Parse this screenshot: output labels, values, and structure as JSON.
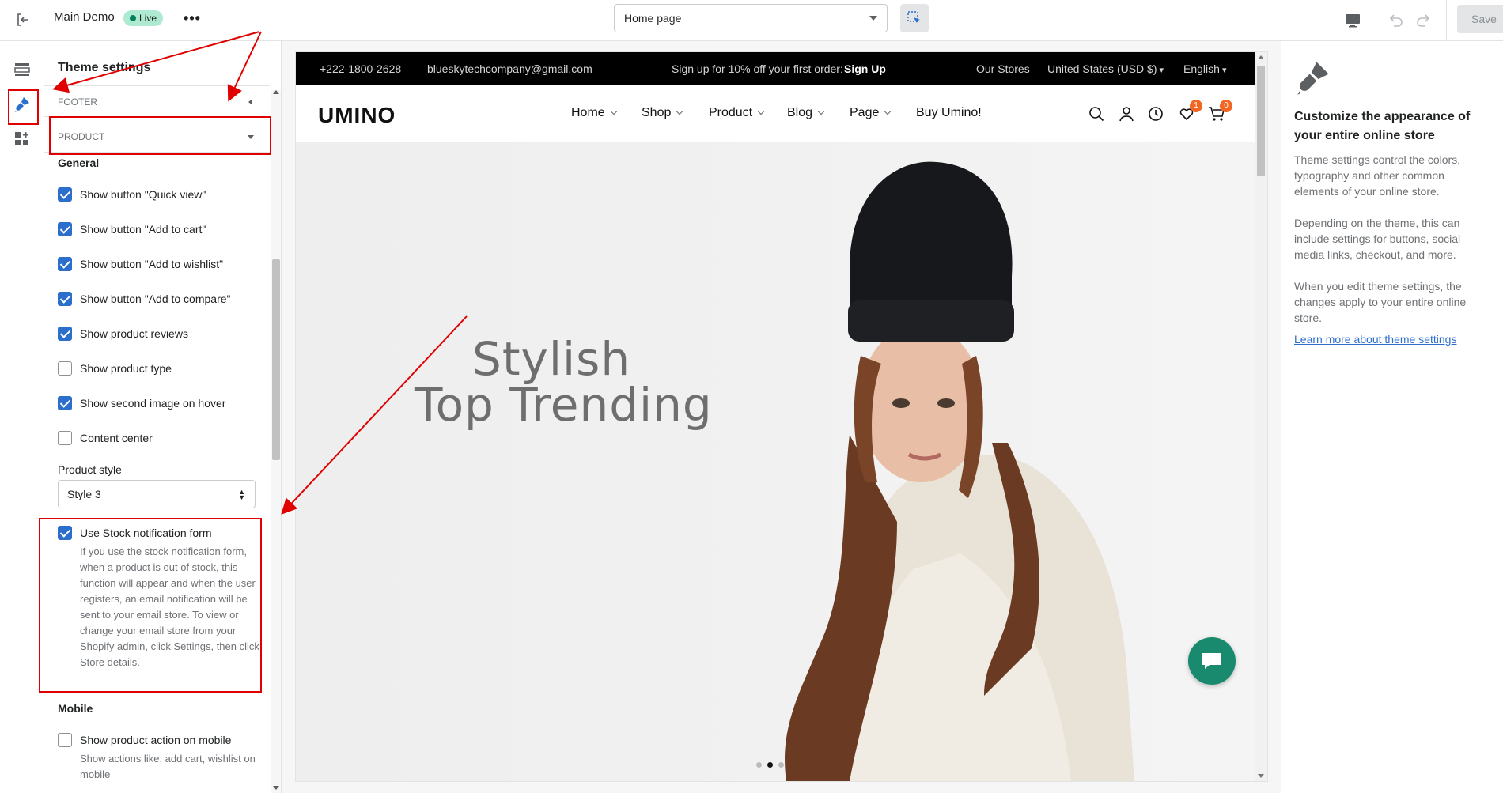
{
  "topbar": {
    "theme_name": "Main Demo",
    "status_badge": "Live",
    "more_label": "•••",
    "page_select": "Home page",
    "save_label": "Save"
  },
  "panel": {
    "title": "Theme settings",
    "sections": [
      "FOOTER",
      "PRODUCT"
    ],
    "general_heading": "General",
    "checkboxes": [
      {
        "label": "Show button \"Quick view\"",
        "checked": true
      },
      {
        "label": "Show button \"Add to cart\"",
        "checked": true
      },
      {
        "label": "Show button \"Add to wishlist\"",
        "checked": true
      },
      {
        "label": "Show button \"Add to compare\"",
        "checked": true
      },
      {
        "label": "Show product reviews",
        "checked": true
      },
      {
        "label": "Show product type",
        "checked": false
      },
      {
        "label": "Show second image on hover",
        "checked": true
      },
      {
        "label": "Content center",
        "checked": false
      }
    ],
    "product_style_label": "Product style",
    "product_style_value": "Style 3",
    "stock": {
      "label": "Use Stock notification form",
      "checked": true,
      "help": "If you use the stock notification form, when a product is out of stock, this function will appear and when the user registers, an email notification will be sent to your email store. To view or change your email store from your Shopify admin, click Settings, then click Store details."
    },
    "mobile_heading": "Mobile",
    "mobile_action": {
      "label": "Show product action on mobile",
      "checked": false,
      "help": "Show actions like: add cart, wishlist on mobile"
    }
  },
  "store": {
    "phone": "+222-1800-2628",
    "email": "blueskytechcompany@gmail.com",
    "promo": "Sign up for 10% off your first order:",
    "promo_link": "Sign Up",
    "stores_link": "Our Stores",
    "currency": "United States (USD $)",
    "language": "English",
    "logo": "UMINO",
    "nav": [
      "Home",
      "Shop",
      "Product",
      "Blog",
      "Page",
      "Buy Umino!"
    ],
    "wishlist_count": "1",
    "cart_count": "0",
    "hero_line1": "Stylish",
    "hero_line2": "Top Trending",
    "slide_index": 2,
    "slide_count": 3
  },
  "info": {
    "title": "Customize the appearance of your entire online store",
    "p1": "Theme settings control the colors, typography and other common elements of your online store.",
    "p2": "Depending on the theme, this can include settings for buttons, social media links, checkout, and more.",
    "p3": "When you edit theme settings, the changes apply to your entire online store.",
    "link": "Learn more about theme settings"
  },
  "colors": {
    "accent": "#2c6ecb",
    "annotation": "#e00000",
    "badge": "#f26522",
    "chat": "#1a8a6e"
  }
}
